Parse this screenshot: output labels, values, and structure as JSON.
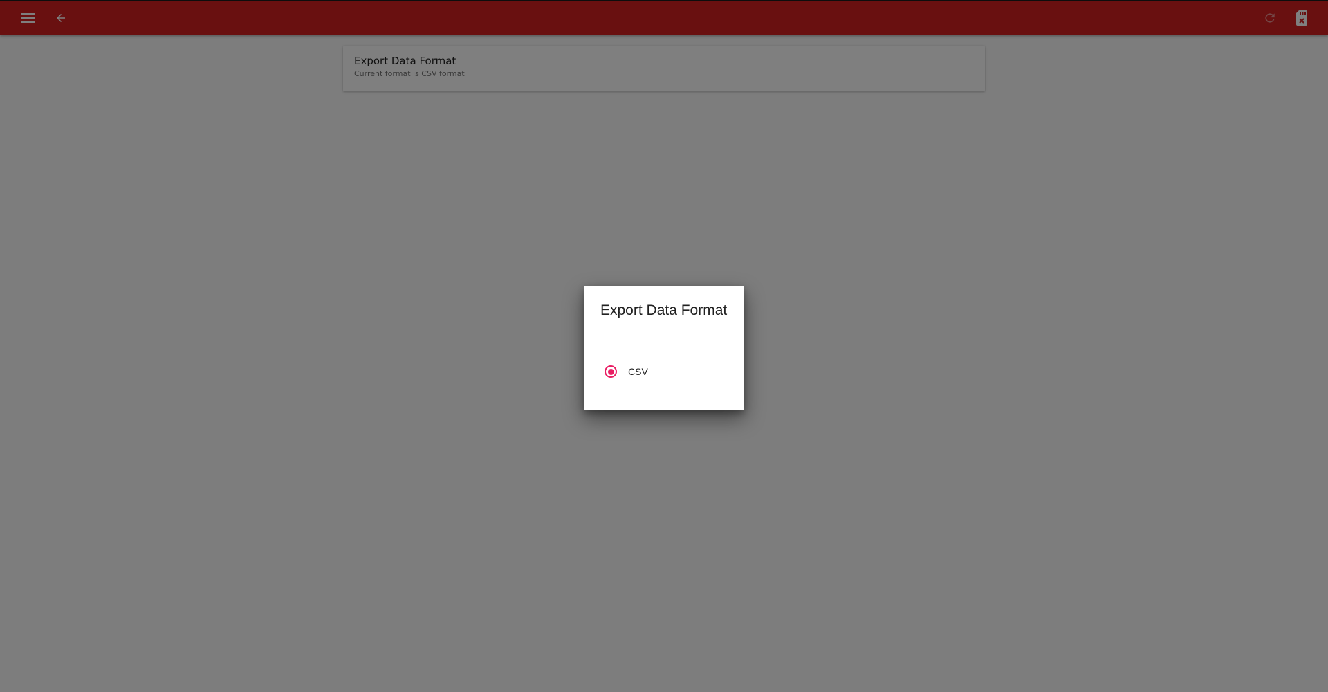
{
  "colors": {
    "toolbar": "#d32121",
    "accent": "#e91e63",
    "overlay": "rgba(0,0,0,0.5)"
  },
  "toolbar": {
    "icons": [
      "menu-icon",
      "back-arrow-icon",
      "refresh-icon",
      "sd-card-icon"
    ]
  },
  "preference": {
    "title": "Export Data Format",
    "summary": "Current format is CSV format"
  },
  "dialog": {
    "title": "Export Data Format",
    "options": [
      {
        "label": "CSV",
        "selected": true
      }
    ]
  }
}
